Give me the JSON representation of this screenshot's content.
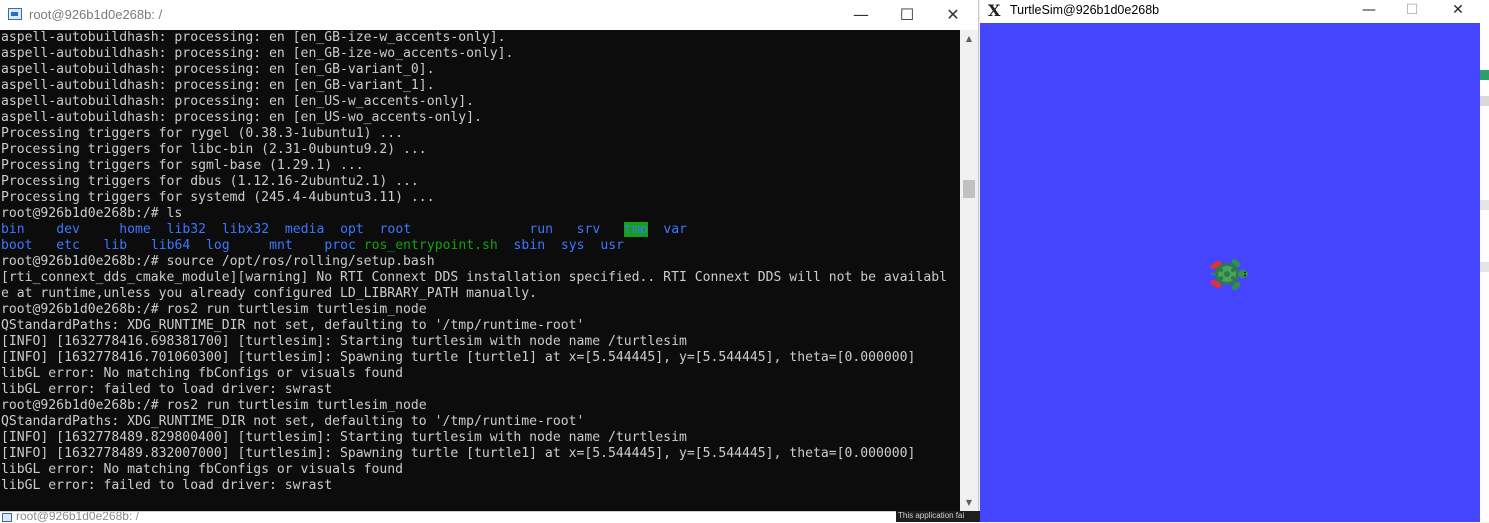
{
  "terminal": {
    "title": "root@926b1d0e268b: /",
    "controls": {
      "minimize": "—",
      "maximize": "☐",
      "close": "✕"
    },
    "lines": [
      "aspell-autobuildhash: processing: en [en_GB-ize-w_accents-only].",
      "aspell-autobuildhash: processing: en [en_GB-ize-wo_accents-only].",
      "aspell-autobuildhash: processing: en [en_GB-variant_0].",
      "aspell-autobuildhash: processing: en [en_GB-variant_1].",
      "aspell-autobuildhash: processing: en [en_US-w_accents-only].",
      "aspell-autobuildhash: processing: en [en_US-wo_accents-only].",
      "Processing triggers for rygel (0.38.3-1ubuntu1) ...",
      "Processing triggers for libc-bin (2.31-0ubuntu9.2) ...",
      "Processing triggers for sgml-base (1.29.1) ...",
      "Processing triggers for dbus (1.12.16-2ubuntu2.1) ...",
      "Processing triggers for systemd (245.4-4ubuntu3.11) ...",
      "root@926b1d0e268b:/# ls"
    ],
    "ls_rows": [
      [
        {
          "text": "bin",
          "style": "blue",
          "pad": 4
        },
        {
          "text": "dev",
          "style": "blue",
          "pad": 5
        },
        {
          "text": "home",
          "style": "blue",
          "pad": 2
        },
        {
          "text": "lib32",
          "style": "blue",
          "pad": 2
        },
        {
          "text": "libx32",
          "style": "blue",
          "pad": 2
        },
        {
          "text": "media",
          "style": "blue",
          "pad": 2
        },
        {
          "text": "opt",
          "style": "blue",
          "pad": 2
        },
        {
          "text": "root",
          "style": "blue",
          "pad": 15
        },
        {
          "text": "run",
          "style": "blue",
          "pad": 3
        },
        {
          "text": "srv",
          "style": "blue",
          "pad": 3
        },
        {
          "text": "tmp",
          "style": "highlight",
          "pad": 2
        },
        {
          "text": "var",
          "style": "blue",
          "pad": 0
        }
      ],
      [
        {
          "text": "boot",
          "style": "blue",
          "pad": 3
        },
        {
          "text": "etc",
          "style": "blue",
          "pad": 3
        },
        {
          "text": "lib",
          "style": "blue",
          "pad": 3
        },
        {
          "text": "lib64",
          "style": "blue",
          "pad": 2
        },
        {
          "text": "log",
          "style": "blue",
          "pad": 5
        },
        {
          "text": "mnt",
          "style": "blue",
          "pad": 4
        },
        {
          "text": "proc",
          "style": "blue",
          "pad": 1
        },
        {
          "text": "ros_entrypoint.sh",
          "style": "green",
          "pad": 2
        },
        {
          "text": "sbin",
          "style": "blue",
          "pad": 2
        },
        {
          "text": "sys",
          "style": "blue",
          "pad": 2
        },
        {
          "text": "usr",
          "style": "blue",
          "pad": 0
        }
      ]
    ],
    "lines_after": [
      "root@926b1d0e268b:/# source /opt/ros/rolling/setup.bash",
      "[rti_connext_dds_cmake_module][warning] No RTI Connext DDS installation specified.. RTI Connext DDS will not be availabl",
      "e at runtime,unless you already configured LD_LIBRARY_PATH manually.",
      "root@926b1d0e268b:/# ros2 run turtlesim turtlesim_node",
      "QStandardPaths: XDG_RUNTIME_DIR not set, defaulting to '/tmp/runtime-root'",
      "[INFO] [1632778416.698381700] [turtlesim]: Starting turtlesim with node name /turtlesim",
      "[INFO] [1632778416.701060300] [turtlesim]: Spawning turtle [turtle1] at x=[5.544445], y=[5.544445], theta=[0.000000]",
      "libGL error: No matching fbConfigs or visuals found",
      "libGL error: failed to load driver: swrast",
      "root@926b1d0e268b:/# ros2 run turtlesim turtlesim_node",
      "QStandardPaths: XDG_RUNTIME_DIR not set, defaulting to '/tmp/runtime-root'",
      "[INFO] [1632778489.829800400] [turtlesim]: Starting turtlesim with node name /turtlesim",
      "[INFO] [1632778489.832007000] [turtlesim]: Spawning turtle [turtle1] at x=[5.544445], y=[5.544445], theta=[0.000000]",
      "libGL error: No matching fbConfigs or visuals found",
      "libGL error: failed to load driver: swrast"
    ],
    "colors": {
      "background": "#0c0c0c",
      "text": "#cccccc",
      "dir_blue": "#3b78ff",
      "exec_green": "#13a10e"
    }
  },
  "taskbar": {
    "title": "root@926b1d0e268b: /"
  },
  "partial_app": {
    "text": "This application fai"
  },
  "turtlesim": {
    "title": "TurtleSim@926b1d0e268b",
    "app_icon": "x11-icon",
    "controls": {
      "minimize": "—",
      "maximize": "☐",
      "close": "✕"
    },
    "background": "#4545ff"
  }
}
